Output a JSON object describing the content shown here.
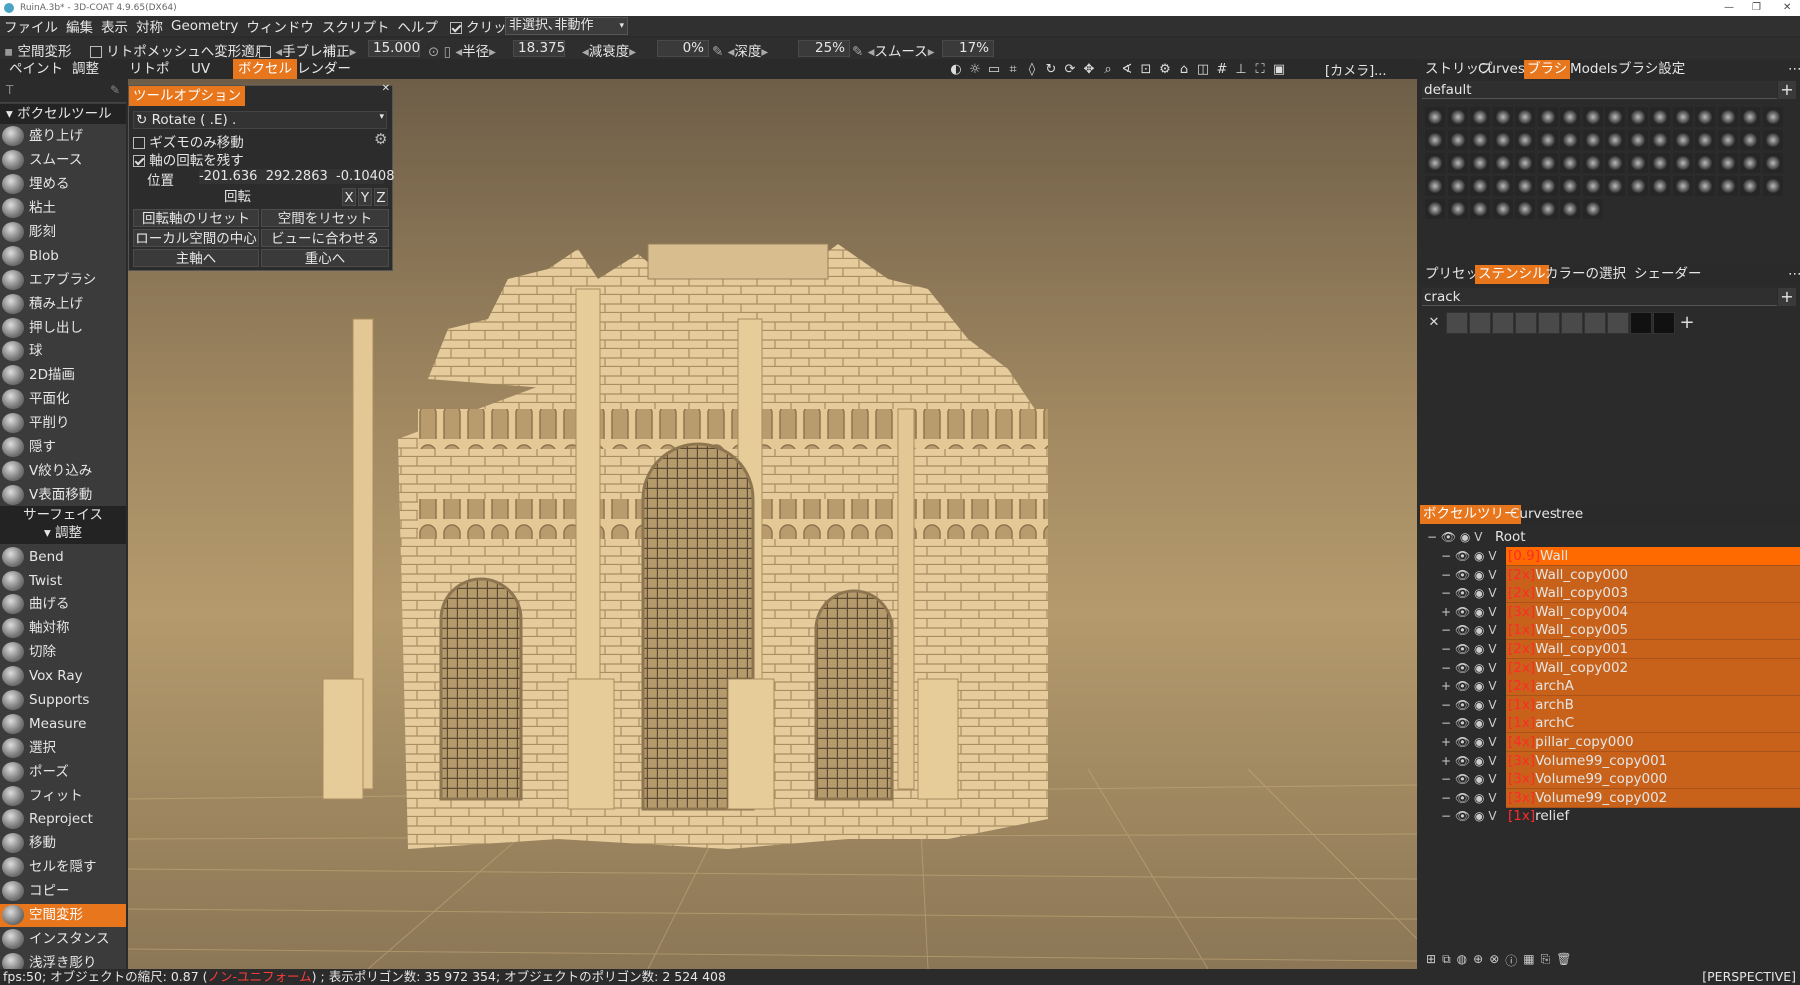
{
  "window": {
    "title": "RuinA.3b* - 3D-COAT 4.9.65(DX64)",
    "controls": [
      "—",
      "❐",
      "✕"
    ]
  },
  "menu": {
    "items": [
      "ファイル",
      "編集",
      "表示",
      "対称",
      "Geometry",
      "ウィンドウ",
      "スクリプト",
      "ヘルプ"
    ],
    "click_select_label": "クリックで選択",
    "selection_mode": "非選択､非動作"
  },
  "toolopts": {
    "space_transform": "空間変形",
    "retopo_label": "リトポメッシュへ変形適用",
    "jitter_label": "手ブレ補正",
    "jitter_value": "15.000",
    "radius_label": "半径",
    "radius_value": "18.375",
    "falloff_label": "減衰度",
    "falloff_value": "0%",
    "depth_label": "深度",
    "depth_value": "25%",
    "smooth_label": "スムース",
    "smooth_value": "17%"
  },
  "modetabs": [
    "ペイント",
    "調整",
    "リトポ",
    "UV",
    "ボクセル",
    "レンダー"
  ],
  "active_mode": "ボクセル",
  "camera_label": "[カメラ]...",
  "left": {
    "search": "T",
    "voxel_header": "ボクセルツール",
    "voxel_tools": [
      "盛り上げ",
      "スムース",
      "埋める",
      "粘土",
      "彫刻",
      "Blob",
      "エアブラシ",
      "積み上げ",
      "押し出し",
      "球",
      "2D描画",
      "平面化",
      "平削り",
      "隠す",
      "V絞り込み",
      "V表面移動"
    ],
    "surface_header_1": "サーフェイス",
    "surface_header_2": "調整",
    "adjust_tools": [
      "Bend",
      "Twist",
      "曲げる",
      "軸対称",
      "切除",
      "Vox Ray",
      "Supports",
      "Measure",
      "選択",
      "ポーズ",
      "フィット",
      "Reproject",
      "移動",
      "セルを隠す",
      "コピー",
      "空間変形",
      "インスタンス",
      "浅浮き彫り"
    ],
    "active_tool": "空間変形"
  },
  "toolpanel": {
    "title": "ツールオプション",
    "mode": "Rotate ( .E) .",
    "gizmo_only": "ギズモのみ移動",
    "keep_axis": "軸の回転を残す",
    "position_label": "位置",
    "pos_x": "-201.636",
    "pos_y": "292.2863",
    "pos_z": "-0.10408",
    "rotate_label": "回転",
    "axes": [
      "X",
      "Y",
      "Z"
    ],
    "buttons": [
      "回転軸のリセット",
      "空間をリセット",
      "ローカル空間の中心",
      "ビューに合わせる",
      "主軸へ",
      "重心へ"
    ]
  },
  "right": {
    "top_tabs": [
      "ストリップ",
      "Curves",
      "ブラシ",
      "Models",
      "ブラシ設定"
    ],
    "active_top": "ブラシ",
    "brush_set": "default",
    "mid_tabs": [
      "プリセット",
      "ステンシル",
      "カラーの選択",
      "シェーダー"
    ],
    "active_mid": "ステンシル",
    "stencil_set": "crack",
    "tree_tabs": [
      "ボクセルツリー",
      "Curves",
      "tree"
    ],
    "active_tree": "ボクセルツリー",
    "root": "Root",
    "layers": [
      {
        "tag": "[0.9]",
        "name": "Wall",
        "exp": "−"
      },
      {
        "tag": "[2x]",
        "name": "Wall_copy000",
        "exp": "−"
      },
      {
        "tag": "[2x]",
        "name": "Wall_copy003",
        "exp": "−"
      },
      {
        "tag": "[3x]",
        "name": "Wall_copy004",
        "exp": "+"
      },
      {
        "tag": "[1x]",
        "name": "Wall_copy005",
        "exp": "−"
      },
      {
        "tag": "[2x]",
        "name": "Wall_copy001",
        "exp": "−"
      },
      {
        "tag": "[2x]",
        "name": "Wall_copy002",
        "exp": "−"
      },
      {
        "tag": "[2x]",
        "name": "archA",
        "exp": "+"
      },
      {
        "tag": "[1x]",
        "name": "archB",
        "exp": "−"
      },
      {
        "tag": "[1x]",
        "name": "archC",
        "exp": "−"
      },
      {
        "tag": "[4x]",
        "name": "pillar_copy000",
        "exp": "+"
      },
      {
        "tag": "[3x]",
        "name": "Volume99_copy001",
        "exp": "+"
      },
      {
        "tag": "[3x]",
        "name": "Volume99_copy000",
        "exp": "−"
      },
      {
        "tag": "[3x]",
        "name": "Volume99_copy002",
        "exp": "−"
      },
      {
        "tag": "[1x]",
        "name": "relief",
        "exp": "−"
      }
    ]
  },
  "status": {
    "prefix": "fps:50; オブジェクトの縮尺: 0.87 (",
    "nonuniform": "ノン-ユニフォーム",
    "suffix": ") ; 表示ポリゴン数: 35 972 354; オブジェクトのポリゴン数: 2 524 408",
    "projection": "[PERSPECTIVE]"
  },
  "colors": {
    "accent": "#e8761c",
    "layer_highlight": "#c8621a",
    "model": "#e8cfa0"
  }
}
